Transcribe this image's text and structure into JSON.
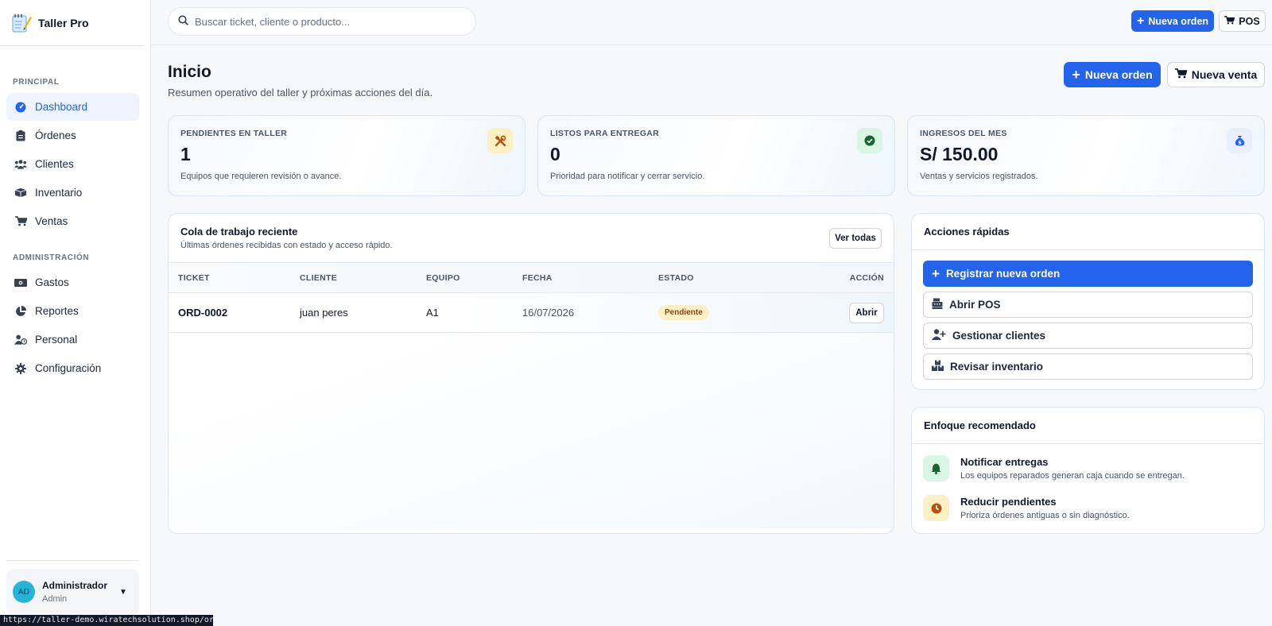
{
  "brand": {
    "title": "Taller Pro"
  },
  "sidebar": {
    "section_principal": "PRINCIPAL",
    "section_admin": "ADMINISTRACIÓN",
    "items_principal": [
      {
        "label": "Dashboard",
        "icon": "dashboard-icon"
      },
      {
        "label": "Órdenes",
        "icon": "clipboard-icon"
      },
      {
        "label": "Clientes",
        "icon": "users-icon"
      },
      {
        "label": "Inventario",
        "icon": "boxes-icon"
      },
      {
        "label": "Ventas",
        "icon": "cart-icon"
      }
    ],
    "items_admin": [
      {
        "label": "Gastos",
        "icon": "money-icon"
      },
      {
        "label": "Reportes",
        "icon": "pie-chart-icon"
      },
      {
        "label": "Personal",
        "icon": "user-clock-icon"
      },
      {
        "label": "Configuración",
        "icon": "gear-icon"
      }
    ]
  },
  "user": {
    "initials": "AD",
    "name": "Administrador",
    "role": "Admin"
  },
  "status_url": "https://taller-demo.wiratechsolution.shop/ordenes",
  "topbar": {
    "search_placeholder": "Buscar ticket, cliente o producto...",
    "new_order": "Nueva orden",
    "pos": "POS"
  },
  "header": {
    "title": "Inicio",
    "subtitle": "Resumen operativo del taller y próximas acciones del día.",
    "new_order": "Nueva orden",
    "new_sale": "Nueva venta"
  },
  "stats": [
    {
      "label": "PENDIENTES EN TALLER",
      "value": "1",
      "desc": "Equipos que requieren revisión o avance.",
      "icon": "tools-icon",
      "color": "#fdf0c4"
    },
    {
      "label": "LISTOS PARA ENTREGAR",
      "value": "0",
      "desc": "Prioridad para notificar y cerrar servicio.",
      "icon": "check-circle-icon",
      "color": "#d9f5e4"
    },
    {
      "label": "INGRESOS DEL MES",
      "value": "S/ 150.00",
      "desc": "Ventas y servicios registrados.",
      "icon": "money-bag-icon",
      "color": "#e8f0fd"
    }
  ],
  "queue": {
    "title": "Cola de trabajo reciente",
    "subtitle": "Últimas órdenes recibidas con estado y acceso rápido.",
    "view_all": "Ver todas",
    "columns": [
      "TICKET",
      "CLIENTE",
      "EQUIPO",
      "FECHA",
      "ESTADO",
      "ACCIÓN"
    ],
    "rows": [
      {
        "ticket": "ORD-0002",
        "cliente": "juan peres",
        "equipo": "A1",
        "fecha": "16/07/2026",
        "estado": "Pendiente",
        "accion": "Abrir"
      }
    ]
  },
  "quick_actions": {
    "title": "Acciones rápidas",
    "items": [
      {
        "label": "Registrar nueva orden",
        "icon": "plus-icon"
      },
      {
        "label": "Abrir POS",
        "icon": "cash-register-icon"
      },
      {
        "label": "Gestionar clientes",
        "icon": "user-plus-icon"
      },
      {
        "label": "Revisar inventario",
        "icon": "boxes-icon"
      }
    ]
  },
  "focus": {
    "title": "Enfoque recomendado",
    "items": [
      {
        "title": "Notificar entregas",
        "desc": "Los equipos reparados generan caja cuando se entregan.",
        "icon": "bell-icon",
        "color": "#d9f5e4"
      },
      {
        "title": "Reducir pendientes",
        "desc": "Prioriza órdenes antiguas o sin diagnóstico.",
        "icon": "clock-icon",
        "color": "#fdf0c4"
      }
    ]
  },
  "colors": {
    "primary": "#2463eb",
    "warning_bg": "#fdf0c4",
    "success_bg": "#d9f5e4"
  }
}
